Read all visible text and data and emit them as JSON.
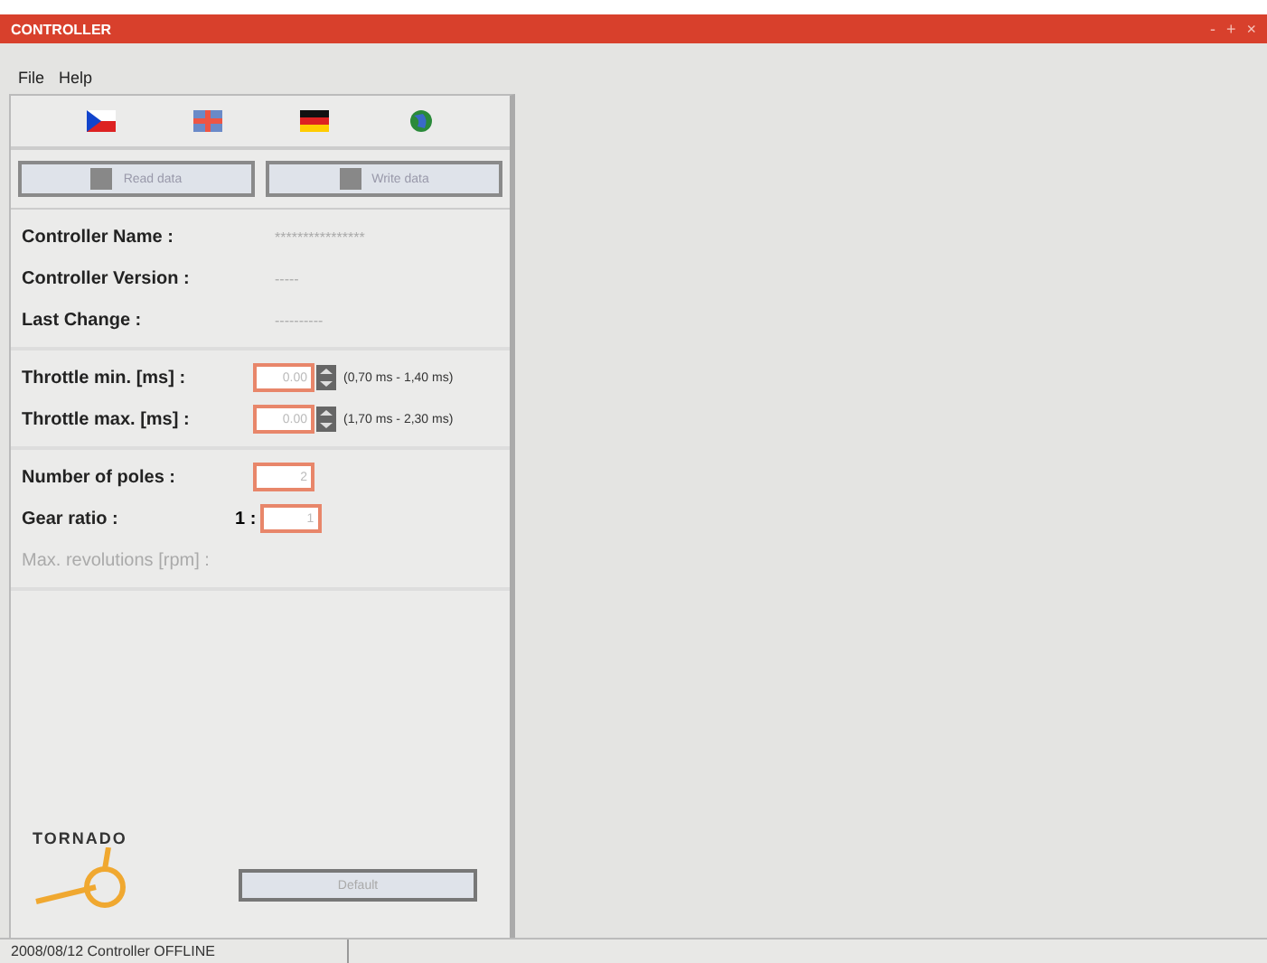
{
  "window": {
    "title": "CONTROLLER",
    "controls": [
      "-",
      "+",
      "×"
    ]
  },
  "menu": [
    "File",
    "Help"
  ],
  "languages": [
    {
      "kind": "czech",
      "selected": false
    },
    {
      "kind": "english",
      "selected": false
    },
    {
      "kind": "german",
      "selected": false
    },
    {
      "kind": "globe",
      "selected": false
    }
  ],
  "actions": [
    {
      "label": "Read data"
    },
    {
      "label": "Write data"
    }
  ],
  "info": [
    {
      "label": "Controller Name :",
      "value": "****************"
    },
    {
      "label": "Controller Version :",
      "value": "-----"
    },
    {
      "label": "Last Change :",
      "value": "----------"
    }
  ],
  "throttle": [
    {
      "label": "Throttle min. [ms] :",
      "value": "0.00",
      "range": "(0,70 ms - 1,40 ms)"
    },
    {
      "label": "Throttle max. [ms] :",
      "value": "0.00",
      "range": "(1,70 ms - 2,30 ms)"
    }
  ],
  "poles": {
    "label": "Number of poles :",
    "value": "2"
  },
  "gear": {
    "label": "Gear ratio :",
    "prefix": "1 :",
    "value": "1"
  },
  "max_revs": {
    "label": "Max. revolutions [rpm] :",
    "disabled": true
  },
  "logo": "TORNADO",
  "default_button": {
    "label": "Default",
    "disabled": true
  },
  "status_bar": "2008/08/12 Controller OFFLINE"
}
